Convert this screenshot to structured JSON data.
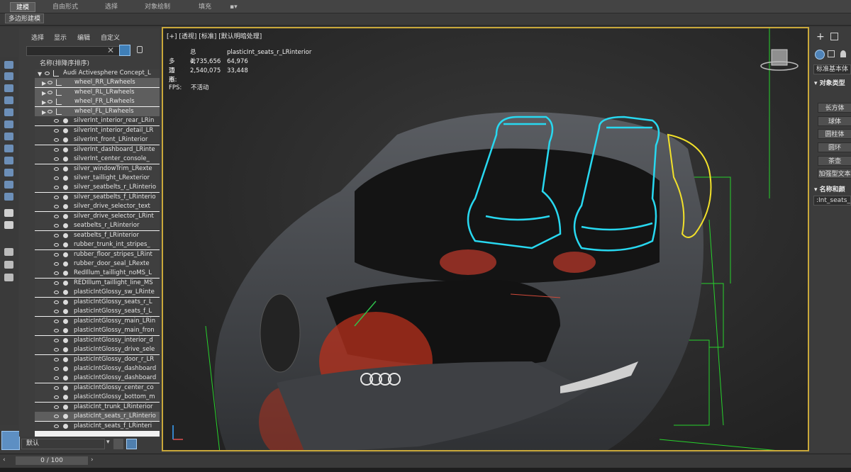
{
  "ribbon": {
    "tabs": [
      "建模",
      "自由形式",
      "选择",
      "对象绘制",
      "填充"
    ],
    "subtab": "多边形建模"
  },
  "explorer": {
    "menu": [
      "选择",
      "显示",
      "编辑",
      "自定义"
    ],
    "header": "名称(排降序排序)",
    "items": [
      "Audi Activesphere Concept_L",
      "wheel_RR_LRwheels",
      "wheel_RL_LRwheels",
      "wheel_FR_LRwheels",
      "wheel_FL_LRwheels",
      "silverInt_interior_rear_LRin",
      "silverInt_interior_detail_LR",
      "silverInt_front_LRinterior",
      "silverInt_dashboard_LRinte",
      "silverInt_center_console_",
      "silver_windowTrim_LRexte",
      "silver_taillight_LRexterior",
      "silver_seatbelts_r_LRinterio",
      "silver_seatbelts_f_LRinterio",
      "silver_drive_selector_text",
      "silver_drive_selector_LRint",
      "seatbelts_r_LRinterior",
      "seatbelts_f_LRinterior",
      "rubber_trunk_int_stripes_",
      "rubber_floor_stripes_LRint",
      "rubber_door_seal_LRexte",
      "RedIllum_taillight_noMS_L",
      "REDIllum_taillight_line_MS",
      "plasticIntGlossy_sw_LRinte",
      "plasticIntGlossy_seats_r_L",
      "plasticIntGlossy_seats_f_L",
      "plasticIntGlossy_main_LRin",
      "plasticIntGlossy_main_fron",
      "plasticIntGlossy_interior_d",
      "plasticIntGlossy_drive_sele",
      "plasticIntGlossy_door_r_LR",
      "plasticIntGlossy_dashboard",
      "plasticIntGlossy_dashboard",
      "plasticIntGlossy_center_co",
      "plasticIntGlossy_bottom_m",
      "plasticInt_trunk_LRinterior",
      "plasticInt_seats_r_LRinterio",
      "plasticInt_seats_f_LRinteri"
    ],
    "layer": "默认"
  },
  "timeline": {
    "frame": "0 / 100"
  },
  "viewport": {
    "label": "[+] [透视] [标准] [默认明暗处理]",
    "stats_head_total": "总计",
    "stats_head_obj": "plasticInt_seats_r_LRinterior",
    "poly_label": "多边形:",
    "poly_total": "4,735,656",
    "poly_obj": "64,976",
    "vert_label": "顶点:",
    "vert_total": "2,540,075",
    "vert_obj": "33,448",
    "fps_label": "FPS:",
    "fps_value": "不活动"
  },
  "cmdpanel": {
    "category": "标准基本体",
    "section1": "对象类型",
    "buttons": [
      "长方体",
      "球体",
      "圆柱体",
      "圆环",
      "茶壶",
      "加强型文本"
    ],
    "section2": "名称和颜",
    "name_field": ":Int_seats_"
  }
}
